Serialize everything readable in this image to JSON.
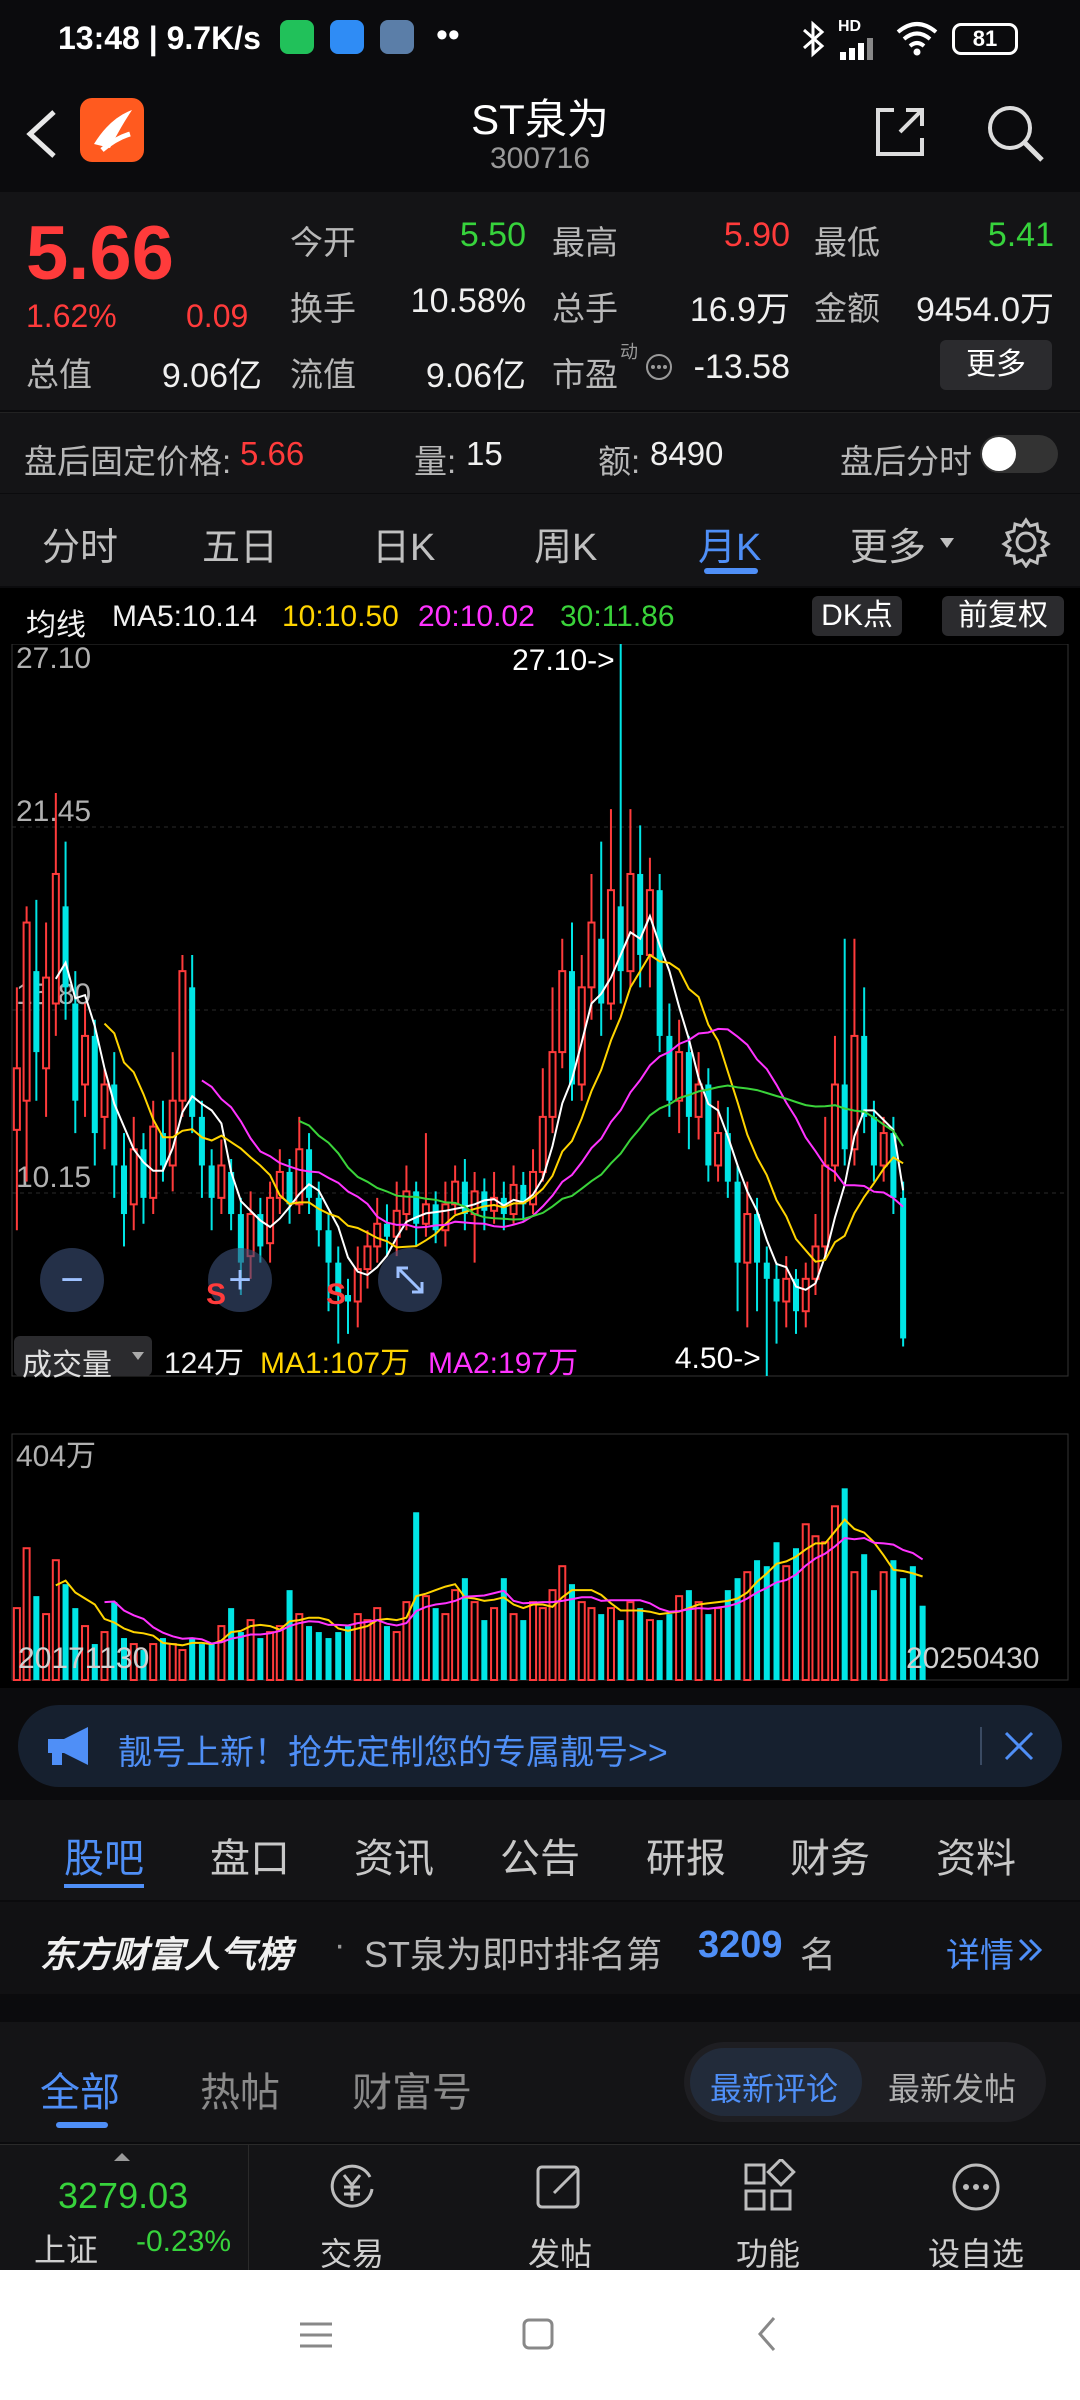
{
  "status_bar": {
    "time_speed": "13:48 | 9.7K/s",
    "battery": "81",
    "signal_label": "HD"
  },
  "header": {
    "title": "ST泉为",
    "code": "300716",
    "brand_color": "#ff5a1f"
  },
  "quote": {
    "price": "5.66",
    "change_pct": "1.62%",
    "change": "0.09",
    "rows": [
      [
        {
          "label": "今开",
          "value": "5.50",
          "color": "#37d33c"
        },
        {
          "label": "最高",
          "value": "5.90",
          "color": "#ff3b3b"
        },
        {
          "label": "最低",
          "value": "5.41",
          "color": "#37d33c"
        }
      ],
      [
        {
          "label": "换手",
          "value": "10.58%",
          "color": "#f0f0f0"
        },
        {
          "label": "总手",
          "value": "16.9万",
          "color": "#f0f0f0"
        },
        {
          "label": "金额",
          "value": "9454.0万",
          "color": "#f0f0f0"
        }
      ]
    ],
    "total_value_label": "总值",
    "total_value": "9.06亿",
    "float_value_label": "流值",
    "float_value": "9.06亿",
    "pe_label": "市盈",
    "pe_superscript": "动",
    "pe_value": "-13.58",
    "more_button": "更多"
  },
  "after_hours": {
    "fixed_price_label": "盘后固定价格:",
    "fixed_price": "5.66",
    "volume_label": "量:",
    "volume": "15",
    "amount_label": "额:",
    "amount": "8490",
    "timeshare_label": "盘后分时",
    "timeshare_on": false
  },
  "chart_tabs": {
    "items": [
      "分时",
      "五日",
      "日K",
      "周K",
      "月K",
      "更多"
    ],
    "active": "月K"
  },
  "ma_legend": {
    "title": "均线",
    "ma5": "MA5:10.14",
    "ma10": "10:10.50",
    "ma20": "20:10.02",
    "ma30": "30:11.86",
    "dk_button": "DK点",
    "adjust_button": "前复权"
  },
  "chart_data": {
    "type": "candlestick",
    "period": "monthly",
    "y_ticks": [
      "27.10",
      "21.45",
      "15.80",
      "10.15",
      "4.50"
    ],
    "ylim": [
      4.5,
      27.1
    ],
    "max_marker": "27.10->",
    "min_marker": "4.50->",
    "x_start": "20171130",
    "x_end": "20250430",
    "price_candles": [
      [
        12.1,
        14.0,
        9.0,
        16.5,
        1
      ],
      [
        13.0,
        18.5,
        10.5,
        19.0,
        1
      ],
      [
        17.0,
        14.5,
        13.0,
        19.2,
        0
      ],
      [
        14.0,
        16.8,
        12.5,
        18.5,
        1
      ],
      [
        16.0,
        20.0,
        15.0,
        22.5,
        1
      ],
      [
        19.0,
        16.5,
        15.5,
        21.0,
        0
      ],
      [
        16.0,
        13.0,
        12.0,
        17.0,
        0
      ],
      [
        13.5,
        15.0,
        12.5,
        16.0,
        1
      ],
      [
        15.0,
        12.0,
        11.0,
        15.5,
        0
      ],
      [
        12.5,
        13.5,
        11.5,
        14.0,
        1
      ],
      [
        13.5,
        11.0,
        10.0,
        14.5,
        0
      ],
      [
        11.0,
        9.5,
        8.5,
        12.0,
        0
      ],
      [
        9.8,
        11.5,
        9.0,
        12.5,
        1
      ],
      [
        11.5,
        10.0,
        9.2,
        12.0,
        0
      ],
      [
        10.0,
        12.2,
        9.5,
        13.0,
        1
      ],
      [
        12.0,
        11.0,
        10.5,
        13.0,
        0
      ],
      [
        11.0,
        13.0,
        10.2,
        14.5,
        1
      ],
      [
        13.0,
        17.0,
        12.5,
        17.5,
        1
      ],
      [
        16.5,
        12.5,
        12.0,
        17.5,
        0
      ],
      [
        12.5,
        11.0,
        10.0,
        13.0,
        0
      ],
      [
        11.0,
        10.0,
        9.0,
        11.5,
        0
      ],
      [
        10.0,
        11.0,
        9.5,
        11.8,
        1
      ],
      [
        10.8,
        9.5,
        9.0,
        11.2,
        0
      ],
      [
        9.5,
        8.0,
        7.0,
        10.0,
        0
      ],
      [
        8.2,
        9.5,
        7.5,
        10.2,
        1
      ],
      [
        9.5,
        8.5,
        8.0,
        10.0,
        0
      ],
      [
        8.6,
        10.0,
        8.0,
        10.5,
        1
      ],
      [
        10.0,
        10.8,
        9.5,
        11.5,
        1
      ],
      [
        10.8,
        9.8,
        9.2,
        11.2,
        0
      ],
      [
        9.8,
        11.5,
        9.5,
        12.5,
        1
      ],
      [
        11.5,
        10.0,
        9.5,
        12.0,
        0
      ],
      [
        10.0,
        9.0,
        8.5,
        10.5,
        0
      ],
      [
        9.0,
        8.0,
        6.5,
        9.5,
        0
      ],
      [
        8.0,
        7.0,
        5.5,
        8.5,
        0
      ],
      [
        7.0,
        6.8,
        5.8,
        7.5,
        0
      ],
      [
        6.8,
        7.8,
        6.0,
        8.5,
        1
      ],
      [
        7.8,
        8.5,
        7.2,
        9.0,
        1
      ],
      [
        8.5,
        9.2,
        8.0,
        10.0,
        1
      ],
      [
        9.2,
        8.8,
        8.2,
        9.8,
        0
      ],
      [
        8.8,
        9.6,
        8.2,
        10.5,
        1
      ],
      [
        9.5,
        10.2,
        9.0,
        11.0,
        1
      ],
      [
        10.2,
        9.2,
        8.5,
        10.5,
        0
      ],
      [
        9.2,
        9.8,
        8.8,
        12.0,
        1
      ],
      [
        9.8,
        9.0,
        8.6,
        10.2,
        0
      ],
      [
        9.0,
        9.8,
        8.5,
        10.5,
        1
      ],
      [
        9.8,
        10.5,
        9.5,
        11.0,
        1
      ],
      [
        10.5,
        9.5,
        9.0,
        11.2,
        0
      ],
      [
        9.5,
        10.2,
        8.0,
        10.8,
        1
      ],
      [
        10.2,
        9.6,
        9.0,
        10.6,
        0
      ],
      [
        9.6,
        10.0,
        9.2,
        10.8,
        1
      ],
      [
        10.0,
        9.5,
        9.0,
        10.5,
        0
      ],
      [
        9.5,
        10.4,
        9.2,
        11.0,
        1
      ],
      [
        10.4,
        9.8,
        9.3,
        10.8,
        0
      ],
      [
        9.8,
        10.8,
        9.5,
        11.5,
        1
      ],
      [
        10.8,
        12.5,
        10.5,
        14.0,
        1
      ],
      [
        12.5,
        14.5,
        12.0,
        16.5,
        1
      ],
      [
        14.5,
        17.0,
        14.0,
        18.0,
        1
      ],
      [
        17.0,
        13.5,
        13.0,
        18.5,
        0
      ],
      [
        13.5,
        16.5,
        13.0,
        17.5,
        1
      ],
      [
        16.5,
        18.5,
        15.5,
        20.0,
        1
      ],
      [
        18.0,
        16.0,
        15.0,
        21.0,
        0
      ],
      [
        16.0,
        19.5,
        15.5,
        22.0,
        1
      ],
      [
        19.0,
        17.0,
        16.0,
        27.1,
        0
      ],
      [
        17.0,
        20.0,
        16.5,
        22.0,
        1
      ],
      [
        20.0,
        17.5,
        16.5,
        21.5,
        0
      ],
      [
        17.5,
        19.5,
        16.5,
        20.5,
        1
      ],
      [
        19.5,
        15.0,
        14.5,
        20.0,
        0
      ],
      [
        15.0,
        13.0,
        12.5,
        16.0,
        0
      ],
      [
        13.0,
        14.5,
        12.0,
        15.5,
        1
      ],
      [
        14.5,
        12.5,
        11.5,
        15.0,
        0
      ],
      [
        12.5,
        13.5,
        11.8,
        14.5,
        1
      ],
      [
        13.5,
        11.0,
        10.5,
        14.0,
        0
      ],
      [
        11.0,
        12.0,
        10.5,
        13.0,
        1
      ],
      [
        12.0,
        10.5,
        10.0,
        12.8,
        0
      ],
      [
        10.5,
        8.0,
        6.5,
        11.0,
        0
      ],
      [
        8.0,
        9.5,
        6.0,
        10.5,
        1
      ],
      [
        9.5,
        8.0,
        6.5,
        10.0,
        0
      ],
      [
        8.0,
        7.5,
        4.5,
        8.5,
        0
      ],
      [
        7.5,
        6.8,
        5.5,
        8.0,
        0
      ],
      [
        6.8,
        7.5,
        6.0,
        8.2,
        1
      ],
      [
        7.5,
        6.5,
        5.8,
        7.8,
        0
      ],
      [
        6.5,
        7.5,
        6.0,
        8.0,
        1
      ],
      [
        7.5,
        8.5,
        7.0,
        9.5,
        1
      ],
      [
        8.5,
        11.0,
        8.2,
        12.5,
        1
      ],
      [
        11.0,
        13.5,
        10.5,
        15.0,
        1
      ],
      [
        13.5,
        11.5,
        11.0,
        18.0,
        0
      ],
      [
        11.5,
        15.0,
        11.0,
        18.0,
        1
      ],
      [
        15.0,
        12.5,
        12.0,
        16.5,
        0
      ],
      [
        12.5,
        11.0,
        10.5,
        13.0,
        0
      ],
      [
        11.0,
        12.0,
        10.5,
        12.5,
        1
      ],
      [
        12.0,
        10.0,
        9.5,
        12.5,
        0
      ],
      [
        10.0,
        5.66,
        5.41,
        10.5,
        0
      ]
    ],
    "ma_series": [
      {
        "name": "MA5",
        "color": "#ffffff"
      },
      {
        "name": "MA10",
        "color": "#ffd400"
      },
      {
        "name": "MA20",
        "color": "#ff33ff"
      },
      {
        "name": "MA30",
        "color": "#3ad33a"
      }
    ],
    "volume_ylim_max": "404万",
    "volume": [
      120,
      220,
      140,
      110,
      200,
      160,
      120,
      90,
      60,
      80,
      130,
      70,
      60,
      50,
      60,
      70,
      60,
      50,
      70,
      60,
      60,
      90,
      120,
      80,
      100,
      70,
      80,
      90,
      150,
      110,
      90,
      80,
      70,
      80,
      90,
      110,
      100,
      120,
      90,
      80,
      130,
      280,
      140,
      120,
      110,
      150,
      170,
      130,
      100,
      120,
      170,
      110,
      100,
      130,
      120,
      150,
      190,
      160,
      130,
      120,
      110,
      120,
      100,
      130,
      120,
      100,
      100,
      110,
      140,
      150,
      130,
      110,
      120,
      150,
      170,
      180,
      200,
      190,
      230,
      190,
      220,
      260,
      240,
      230,
      290,
      320,
      180,
      210,
      150,
      180,
      200,
      170,
      190,
      124
    ]
  },
  "volume_legend": {
    "dropdown": "成交量",
    "current": "124万",
    "ma1": "MA1:107万",
    "ma2": "MA2:197万"
  },
  "chart_tools": {
    "minus": "−",
    "plus": "+",
    "signal_s": "S"
  },
  "banner": {
    "text": "靓号上新！抢先定制您的专属靓号>>"
  },
  "news_tabs": {
    "items": [
      "股吧",
      "盘口",
      "资讯",
      "公告",
      "研报",
      "财务",
      "资料"
    ],
    "active": "股吧"
  },
  "rank": {
    "brand": "东方财富人气榜",
    "dot": "·",
    "prefix": "ST泉为即时排名第",
    "number": "3209",
    "suffix": "名",
    "link": "详情"
  },
  "filter": {
    "tabs": [
      "全部",
      "热帖",
      "财富号"
    ],
    "active": "全部",
    "sort_options": [
      "最新评论",
      "最新发帖"
    ],
    "sort_active": "最新评论"
  },
  "bottom_bar": {
    "index_value": "3279.03",
    "index_name": "上证",
    "index_change": "-0.23%",
    "items": [
      "交易",
      "发帖",
      "功能",
      "设自选"
    ]
  }
}
